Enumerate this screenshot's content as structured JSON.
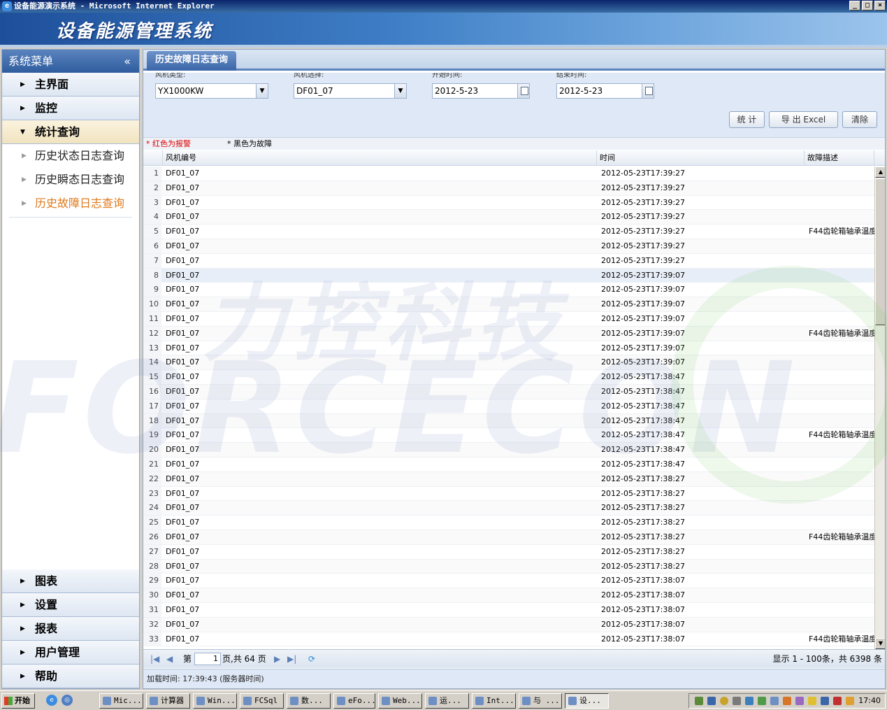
{
  "window": {
    "title": "设备能源演示系统 - Microsoft Internet Explorer",
    "minimize": "_",
    "maximize": "□",
    "close": "×"
  },
  "banner": {
    "title": "设备能源管理系统"
  },
  "sidebar": {
    "header": "系统菜单",
    "collapse": "«",
    "top_items": [
      {
        "label": "主界面"
      },
      {
        "label": "监控"
      },
      {
        "label": "统计查询"
      }
    ],
    "sub_items": [
      {
        "label": "历史状态日志查询"
      },
      {
        "label": "历史瞬态日志查询"
      },
      {
        "label": "历史故障日志查询"
      }
    ],
    "bottom_items": [
      {
        "label": "图表"
      },
      {
        "label": "设置"
      },
      {
        "label": "报表"
      },
      {
        "label": "用户管理"
      },
      {
        "label": "帮助"
      }
    ]
  },
  "main": {
    "tab": "历史故障日志查询",
    "filters": {
      "type_label": "风机类型:",
      "type_value": "YX1000KW",
      "select_label": "风机选择:",
      "select_value": "DF01_07",
      "start_label": "开始时间:",
      "start_value": "2012-5-23",
      "end_label": "结束时间:",
      "end_value": "2012-5-23"
    },
    "buttons": {
      "stat": "统 计",
      "export": "导 出 Excel",
      "clear": "清除"
    },
    "legend": {
      "red": "* 红色为报警",
      "black": "* 黑色为故障"
    },
    "grid": {
      "columns": [
        "风机编号",
        "时间",
        "故障描述"
      ],
      "rows": [
        [
          "1",
          "DF01_07",
          "2012-05-23T17:39:27",
          ""
        ],
        [
          "2",
          "DF01_07",
          "2012-05-23T17:39:27",
          ""
        ],
        [
          "3",
          "DF01_07",
          "2012-05-23T17:39:27",
          ""
        ],
        [
          "4",
          "DF01_07",
          "2012-05-23T17:39:27",
          ""
        ],
        [
          "5",
          "DF01_07",
          "2012-05-23T17:39:27",
          "F44齿轮箱轴承温度"
        ],
        [
          "6",
          "DF01_07",
          "2012-05-23T17:39:27",
          ""
        ],
        [
          "7",
          "DF01_07",
          "2012-05-23T17:39:27",
          ""
        ],
        [
          "8",
          "DF01_07",
          "2012-05-23T17:39:07",
          ""
        ],
        [
          "9",
          "DF01_07",
          "2012-05-23T17:39:07",
          ""
        ],
        [
          "10",
          "DF01_07",
          "2012-05-23T17:39:07",
          ""
        ],
        [
          "11",
          "DF01_07",
          "2012-05-23T17:39:07",
          ""
        ],
        [
          "12",
          "DF01_07",
          "2012-05-23T17:39:07",
          "F44齿轮箱轴承温度"
        ],
        [
          "13",
          "DF01_07",
          "2012-05-23T17:39:07",
          ""
        ],
        [
          "14",
          "DF01_07",
          "2012-05-23T17:39:07",
          ""
        ],
        [
          "15",
          "DF01_07",
          "2012-05-23T17:38:47",
          ""
        ],
        [
          "16",
          "DF01_07",
          "2012-05-23T17:38:47",
          ""
        ],
        [
          "17",
          "DF01_07",
          "2012-05-23T17:38:47",
          ""
        ],
        [
          "18",
          "DF01_07",
          "2012-05-23T17:38:47",
          ""
        ],
        [
          "19",
          "DF01_07",
          "2012-05-23T17:38:47",
          "F44齿轮箱轴承温度"
        ],
        [
          "20",
          "DF01_07",
          "2012-05-23T17:38:47",
          ""
        ],
        [
          "21",
          "DF01_07",
          "2012-05-23T17:38:47",
          ""
        ],
        [
          "22",
          "DF01_07",
          "2012-05-23T17:38:27",
          ""
        ],
        [
          "23",
          "DF01_07",
          "2012-05-23T17:38:27",
          ""
        ],
        [
          "24",
          "DF01_07",
          "2012-05-23T17:38:27",
          ""
        ],
        [
          "25",
          "DF01_07",
          "2012-05-23T17:38:27",
          ""
        ],
        [
          "26",
          "DF01_07",
          "2012-05-23T17:38:27",
          "F44齿轮箱轴承温度"
        ],
        [
          "27",
          "DF01_07",
          "2012-05-23T17:38:27",
          ""
        ],
        [
          "28",
          "DF01_07",
          "2012-05-23T17:38:27",
          ""
        ],
        [
          "29",
          "DF01_07",
          "2012-05-23T17:38:07",
          ""
        ],
        [
          "30",
          "DF01_07",
          "2012-05-23T17:38:07",
          ""
        ],
        [
          "31",
          "DF01_07",
          "2012-05-23T17:38:07",
          ""
        ],
        [
          "32",
          "DF01_07",
          "2012-05-23T17:38:07",
          ""
        ],
        [
          "33",
          "DF01_07",
          "2012-05-23T17:38:07",
          "F44齿轮箱轴承温度"
        ]
      ]
    },
    "pager": {
      "page_prefix": "第",
      "page_value": "1",
      "page_suffix": "页,共 64 页",
      "display": "显示 1 - 100条，共 6398 条"
    },
    "status": "加载时间: 17:39:43 (服务器时间)"
  },
  "watermark": {
    "line1": "力控科技",
    "line2": "FORCECON"
  },
  "taskbar": {
    "start": "开始",
    "buttons": [
      "Mic...",
      "计算器",
      "Win...",
      "FCSql",
      "数...",
      "eFo...",
      "Web...",
      "运...",
      "Int...",
      "与 ...",
      "设..."
    ],
    "clock": "17:40"
  },
  "colors": {
    "accent": "#3b66a8",
    "alarm": "#e00000",
    "current_menu": "#e07a1d"
  }
}
